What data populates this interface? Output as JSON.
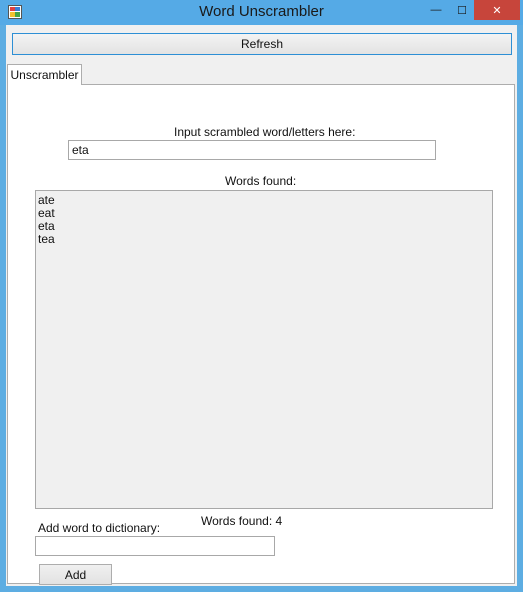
{
  "window": {
    "title": "Word Unscrambler",
    "controls": {
      "minimize": "—",
      "maximize": "☐",
      "close": "✕"
    }
  },
  "toolbar": {
    "refresh_label": "Refresh"
  },
  "tabs": [
    {
      "label": "Unscrambler",
      "active": true
    }
  ],
  "unscrambler": {
    "input_label": "Input scrambled word/letters here:",
    "input_value": "eta",
    "words_found_label": "Words found:",
    "words": [
      "ate",
      "eat",
      "eta",
      "tea"
    ],
    "words_found_count_text": "Words found: 4",
    "add_word_label": "Add word to dictionary:",
    "add_word_value": "",
    "add_button_label": "Add"
  },
  "colors": {
    "titlebar": "#55aae6",
    "close_button": "#c7453b",
    "accent_border": "#2d8fd5"
  }
}
